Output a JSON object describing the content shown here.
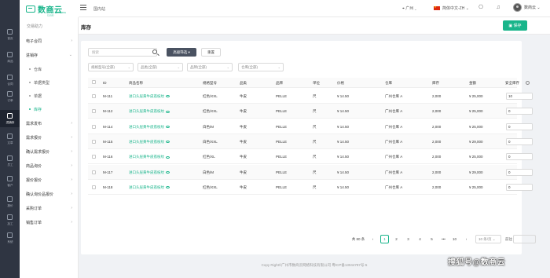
{
  "rail": [
    {
      "label": "首页",
      "icon": "home-icon"
    },
    {
      "label": "商品",
      "icon": "goods-icon"
    },
    {
      "label": "合同",
      "icon": "contract-icon"
    },
    {
      "label": "订单",
      "icon": "order-icon"
    },
    {
      "label": "进销存",
      "icon": "stock-icon"
    },
    {
      "label": "文章",
      "icon": "article-icon"
    },
    {
      "label": "员工",
      "icon": "staff-icon"
    },
    {
      "label": "客户",
      "icon": "customer-icon"
    },
    {
      "label": "报价",
      "icon": "quote-icon"
    },
    {
      "label": "加工",
      "icon": "process-icon"
    },
    {
      "label": "系统",
      "icon": "system-icon"
    }
  ],
  "logo": {
    "text": "数商云",
    "sub": "DIGITAL COMMERCE CLOUD"
  },
  "sidebar": {
    "head": "交易助力",
    "items": [
      {
        "label": "电子合同",
        "chevron": "›"
      },
      {
        "label": "进销存",
        "chevron": "⌄"
      },
      {
        "label": "仓库",
        "sub": true
      },
      {
        "label": "单据类型",
        "sub": true
      },
      {
        "label": "单据",
        "sub": true
      },
      {
        "label": "库存",
        "sub": true,
        "active": true
      },
      {
        "label": "需求发布",
        "chevron": "›"
      },
      {
        "label": "需求报价",
        "chevron": "›"
      },
      {
        "label": "确认需求报价",
        "chevron": "›"
      },
      {
        "label": "商品询价",
        "chevron": "›"
      },
      {
        "label": "报价报价",
        "chevron": "›"
      },
      {
        "label": "确认询价品报价",
        "chevron": "›"
      },
      {
        "label": "采购订单",
        "chevron": "›"
      },
      {
        "label": "销售订单",
        "chevron": "›"
      }
    ]
  },
  "header": {
    "breadcrumb": "国内站",
    "location": "广州",
    "language": "简体中文-ZH",
    "user": "数商云"
  },
  "page": {
    "title": "库存",
    "save_label": "保存"
  },
  "toolbar": {
    "search_placeholder": "搜索",
    "advanced_label": "高级筛选",
    "reset_label": "重置",
    "filters": [
      "规格型号(全部)",
      "品类(全部)",
      "品牌(全部)",
      "仓库(全部)"
    ]
  },
  "table": {
    "columns": [
      "ID",
      "商品名称",
      "规格型号",
      "品类",
      "品牌",
      "单位",
      "价格",
      "仓库",
      "库存",
      "金额",
      "安全库存"
    ],
    "rows": [
      {
        "id": "M-111",
        "name": "进口头层黄牛皮荔枝纹",
        "spec": "红色/XXL",
        "cat": "牛皮",
        "brand": "PELLE",
        "unit": "尺",
        "price": "¥ 14.50",
        "wh": "广州仓库 A",
        "stock": "2,000",
        "amount": "¥ 25,000",
        "safe": "10"
      },
      {
        "id": "M-112",
        "name": "进口头层黄牛皮荔枝纹",
        "spec": "红色/XXL",
        "cat": "牛皮",
        "brand": "PELLE",
        "unit": "尺",
        "price": "¥ 14.50",
        "wh": "广州仓库 A",
        "stock": "2,000",
        "amount": "¥ 25,000",
        "safe": "0"
      },
      {
        "id": "M-114",
        "name": "进口头层黄牛皮荔枝纹",
        "spec": "白色/M",
        "cat": "牛皮",
        "brand": "PELLE",
        "unit": "尺",
        "price": "¥ 14.50",
        "wh": "广州仓库 A",
        "stock": "2,000",
        "amount": "¥ 25,000",
        "safe": "0"
      },
      {
        "id": "M-115",
        "name": "进口头层黄牛皮荔枝纹",
        "spec": "白色/XXL",
        "cat": "牛皮",
        "brand": "PELLE",
        "unit": "尺",
        "price": "¥ 14.50",
        "wh": "广州仓库 A",
        "stock": "2,000",
        "amount": "¥ 29,000",
        "safe": "0"
      },
      {
        "id": "M-116",
        "name": "进口头层黄牛皮荔枝纹",
        "spec": "红色/XL",
        "cat": "牛皮",
        "brand": "PELLE",
        "unit": "尺",
        "price": "¥ 14.50",
        "wh": "广州仓库 A",
        "stock": "2,000",
        "amount": "¥ 25,000",
        "safe": "0"
      },
      {
        "id": "M-117",
        "name": "进口头层黄牛皮荔枝纹",
        "spec": "白色/M",
        "cat": "牛皮",
        "brand": "PELLE",
        "unit": "尺",
        "price": "¥ 14.50",
        "wh": "广州仓库 A",
        "stock": "2,000",
        "amount": "¥ 29,000",
        "safe": "0"
      },
      {
        "id": "M-118",
        "name": "进口头层黄牛皮荔枝纹",
        "spec": "红色/XXL",
        "cat": "牛皮",
        "brand": "PELLE",
        "unit": "尺",
        "price": "¥ 14.50",
        "wh": "广州仓库 A",
        "stock": "2,000",
        "amount": "¥ 25,000",
        "safe": "0"
      }
    ]
  },
  "pagination": {
    "total": "共 80 条",
    "prev": "‹",
    "pages": [
      "1",
      "2",
      "3",
      "4",
      "5",
      "•••",
      "10"
    ],
    "next": "›",
    "page_size": "10 条/页",
    "goto": "前往"
  },
  "footer": "Copy Right©广州市数商云网络科技有限公司 粤ICP备13044787号-5",
  "watermark": "搜狐号@数商云",
  "colors": {
    "accent": "#19b58b",
    "rail": "#2f3542"
  }
}
